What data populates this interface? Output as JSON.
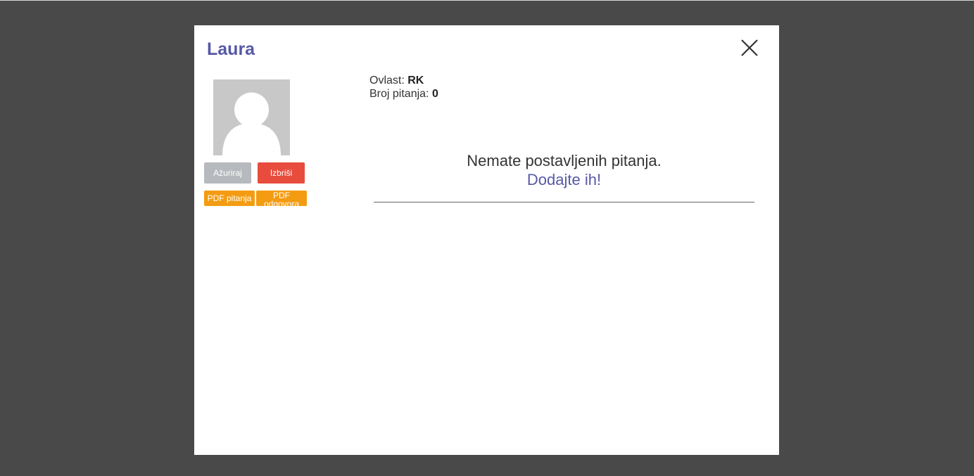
{
  "modal": {
    "user_name": "Laura",
    "close_icon": "close-icon"
  },
  "profile": {
    "avatar_icon": "user-placeholder-icon",
    "buttons": {
      "update_label": "Ažuriraj",
      "delete_label": "Izbriši",
      "pdf_questions_label": "PDF pitanja",
      "pdf_answers_label": "PDF odgovora"
    }
  },
  "info": {
    "role_label": "Ovlast: ",
    "role_value": "RK",
    "questions_label": "Broj pitanja: ",
    "questions_value": "0"
  },
  "empty_state": {
    "message": "Nemate postavljenih pitanja.",
    "link": "Dodajte ih!"
  },
  "colors": {
    "accent": "#5758a6",
    "overlay": "#484948",
    "update_button": "#b6b9bd",
    "delete_button": "#e84c3d",
    "pdf_button": "#f39c12"
  }
}
